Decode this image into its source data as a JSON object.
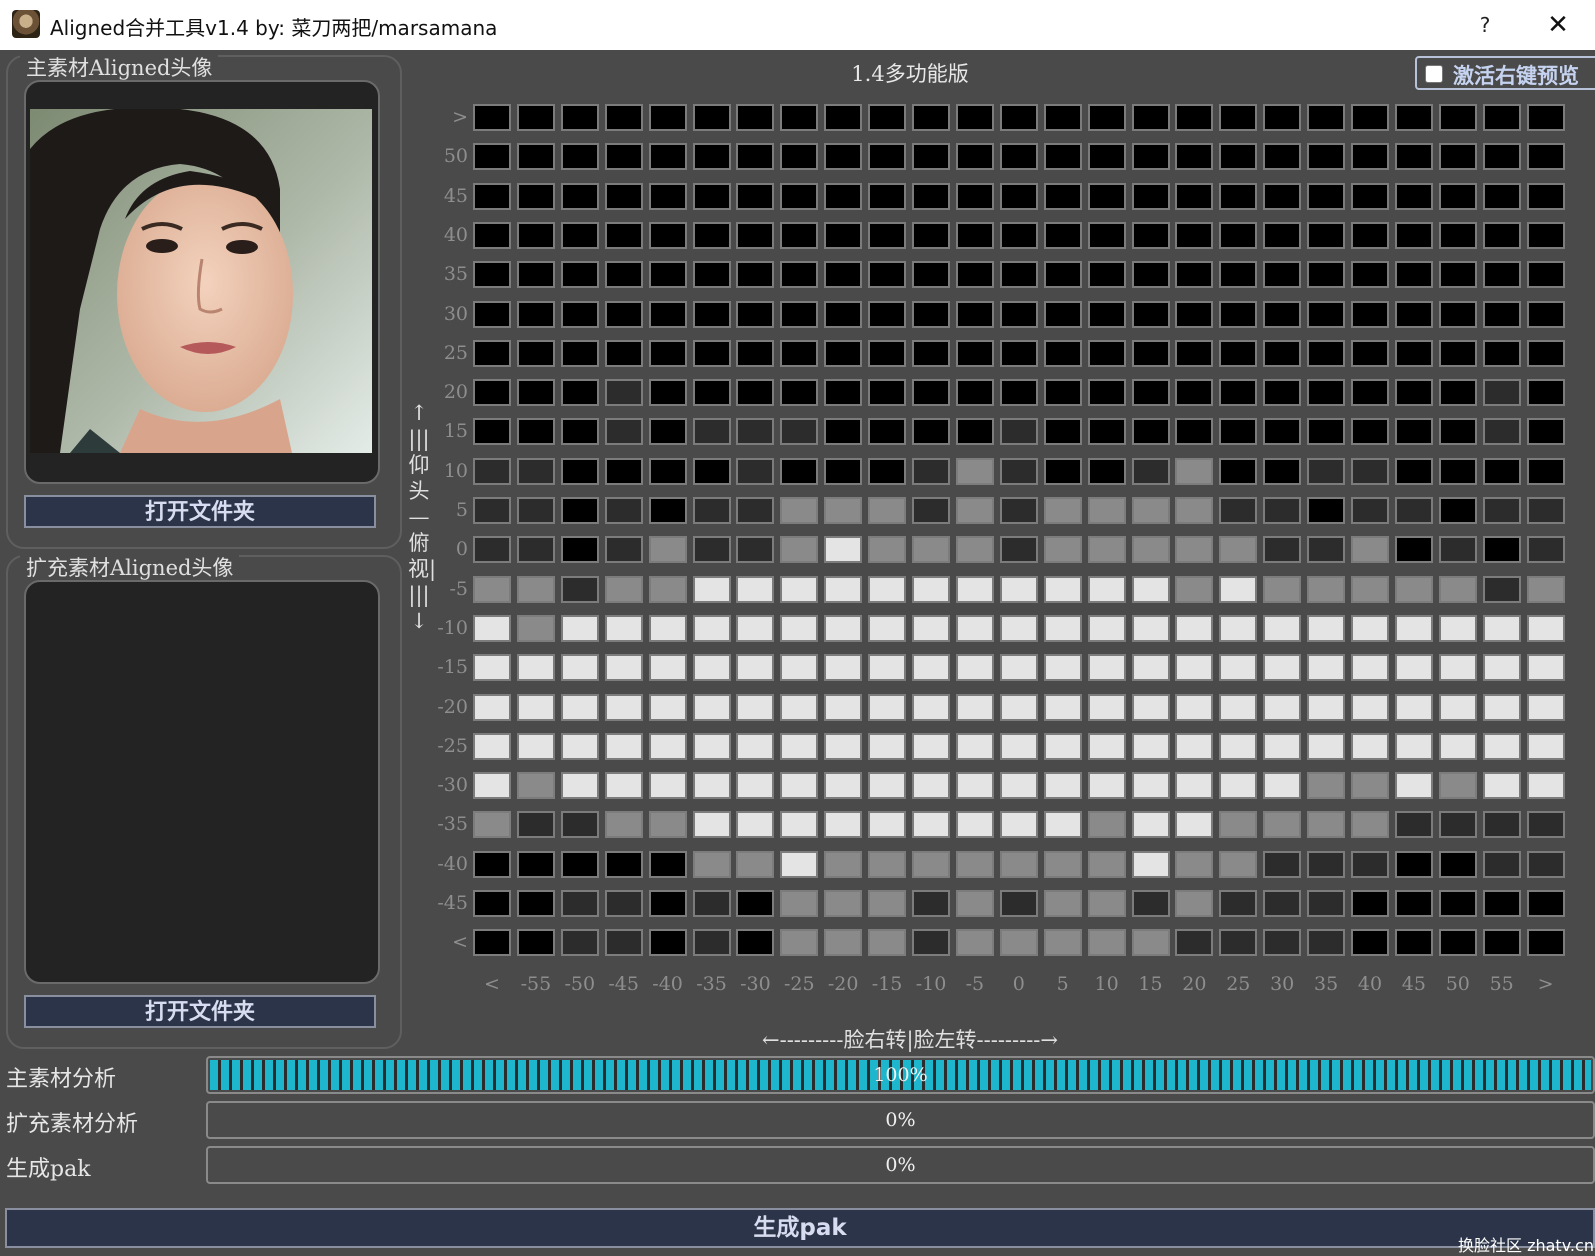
{
  "window": {
    "title": "Aligned合并工具v1.4  by: 菜刀两把/marsamana",
    "help": "?",
    "close": "✕"
  },
  "main_panel": {
    "title": "主素材Aligned头像",
    "open_button": "打开文件夹"
  },
  "extra_panel": {
    "title": "扩充素材Aligned头像",
    "open_button": "打开文件夹"
  },
  "grid": {
    "title": "1.4多功能版",
    "preview_checkbox": {
      "label": "激活右键预览",
      "checked": false
    },
    "y_labels": [
      ">",
      "50",
      "45",
      "40",
      "35",
      "30",
      "25",
      "20",
      "15",
      "10",
      "5",
      "0",
      "-5",
      "-10",
      "-15",
      "-20",
      "-25",
      "-30",
      "-35",
      "-40",
      "-45",
      "<"
    ],
    "x_labels": [
      "<",
      "-55",
      "-50",
      "-45",
      "-40",
      "-35",
      "-30",
      "-25",
      "-20",
      "-15",
      "-10",
      "-5",
      "0",
      "5",
      "10",
      "15",
      "20",
      "25",
      "30",
      "35",
      "40",
      "45",
      "50",
      "55",
      ">"
    ],
    "vertical_axis_label": "↑|||仰头—俯视||||↓",
    "horizontal_axis_label": "←---------脸右转|脸左转---------→",
    "cell_colors": {
      "0": "#000000",
      "1": "#2c2c2c",
      "2": "#8a8a8a",
      "3": "#e4e4e4"
    },
    "cells": [
      "0000000000000000000000000",
      "0000000000000000000000000",
      "0000000000000000000000000",
      "0000000000000000000000000",
      "0000000000000000000000000",
      "0000000000000000000000000",
      "0000000000000000000000000",
      "0001000000000000000000010",
      "0001011100001000000000010",
      "1100001000121001200110000",
      "1101011222121222211011011",
      "1101211232221222221120101",
      "2212233333333333232222212",
      "3233333333333333333333333",
      "3333333333333333333333333",
      "3333333333333333333333333",
      "3333333333333333333333333",
      "3233333333333333333223233",
      "2112233333333323322221111",
      "0000022322222223221110011",
      "0011010222121221211100000",
      "0011010222122222111100000"
    ]
  },
  "progress": [
    {
      "label": "主素材分析",
      "value": 100,
      "text": "100%"
    },
    {
      "label": "扩充素材分析",
      "value": 0,
      "text": "0%"
    },
    {
      "label": "生成pak",
      "value": 0,
      "text": "0%"
    }
  ],
  "generate_button": "生成pak",
  "watermark": "换脸社区 zhatv.cn"
}
